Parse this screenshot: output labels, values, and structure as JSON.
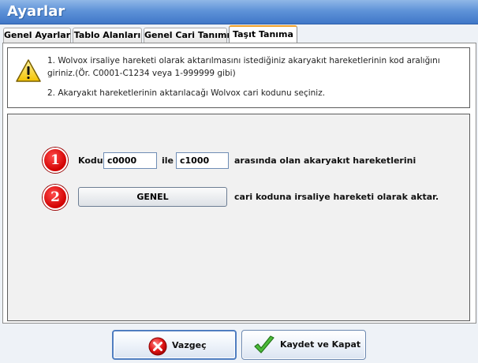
{
  "window": {
    "title": "Ayarlar"
  },
  "tabs": [
    {
      "label": "Genel Ayarlar",
      "active": false
    },
    {
      "label": "Tablo Alanları",
      "active": false
    },
    {
      "label": "Genel Cari Tanımı",
      "active": false
    },
    {
      "label": "Taşıt Tanıma",
      "active": true
    }
  ],
  "info": {
    "icon": "warning-icon",
    "line1": "1. Wolvox irsaliye hareketi olarak aktarılmasını istediğiniz akaryakıt hareketlerinin kod aralığını giriniz.(Ör. C0001-C1234 veya 1-999999 gibi)",
    "line2": "2. Akaryakıt hareketlerinin aktarılacağı Wolvox cari kodunu seçiniz."
  },
  "step1": {
    "badge": "1",
    "kodu_label": "Kodu",
    "from_value": "c0000",
    "ile_label": "ile",
    "to_value": "c1000",
    "suffix": "arasında olan akaryakıt hareketlerini"
  },
  "step2": {
    "badge": "2",
    "button_label": "GENEL",
    "suffix": "cari koduna irsaliye hareketi olarak aktar."
  },
  "footer": {
    "cancel_label": "Vazgeç",
    "cancel_icon": "cancel-x-icon",
    "save_label": "Kaydet ve Kapat",
    "save_icon": "checkmark-icon"
  },
  "colors": {
    "title_bar": "#5f93d8",
    "active_tab_accent": "#f0a12a",
    "badge_red": "#d10000",
    "check_green": "#3aa12c"
  }
}
